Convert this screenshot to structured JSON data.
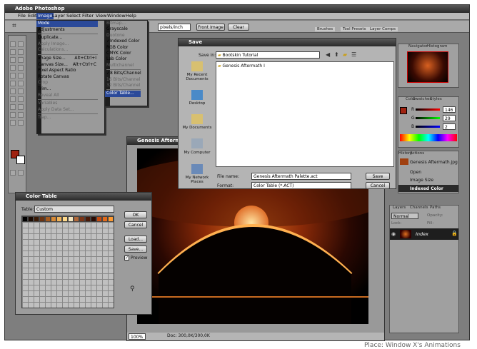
{
  "app": {
    "title": "Adobe Photoshop",
    "close_glyph": "✕",
    "accent": "#1a5fd6"
  },
  "menubar": [
    "File",
    "Edit",
    "Image",
    "Layer",
    "Select",
    "Filter",
    "View",
    "Window",
    "Help"
  ],
  "options": {
    "resolution_unit": "pixels/inch",
    "front_image": "Front Image",
    "clear": "Clear"
  },
  "top_tabs": [
    "Brushes",
    "Tool Presets",
    "Layer Comps"
  ],
  "image_menu": {
    "items": [
      {
        "label": "Mode",
        "hl": true
      },
      {
        "label": "Adjustments"
      },
      {
        "sep": true
      },
      {
        "label": "Duplicate..."
      },
      {
        "label": "Apply Image...",
        "dis": true
      },
      {
        "label": "Calculations...",
        "dis": true
      },
      {
        "sep": true
      },
      {
        "label": "Image Size...",
        "sc": "Alt+Ctrl+I"
      },
      {
        "label": "Canvas Size...",
        "sc": "Alt+Ctrl+C"
      },
      {
        "label": "Pixel Aspect Ratio"
      },
      {
        "label": "Rotate Canvas"
      },
      {
        "label": "Crop",
        "dis": true
      },
      {
        "label": "Trim..."
      },
      {
        "label": "Reveal All",
        "dis": true
      },
      {
        "sep": true
      },
      {
        "label": "Variables",
        "dis": true
      },
      {
        "label": "Apply Data Set...",
        "dis": true
      },
      {
        "sep": true
      },
      {
        "label": "Trap...",
        "dis": true
      }
    ]
  },
  "mode_menu": {
    "items": [
      {
        "label": "Bitmap...",
        "dis": true
      },
      {
        "label": "Grayscale"
      },
      {
        "label": "Duotone",
        "dis": true
      },
      {
        "label": "Indexed Color",
        "chk": true
      },
      {
        "label": "RGB Color"
      },
      {
        "label": "CMYK Color"
      },
      {
        "label": "Lab Color"
      },
      {
        "label": "Multichannel",
        "dis": true
      },
      {
        "sep": true
      },
      {
        "label": "8 Bits/Channel",
        "chk": true
      },
      {
        "label": "16 Bits/Channel",
        "dis": true
      },
      {
        "label": "32 Bits/Channel",
        "dis": true
      },
      {
        "sep": true
      },
      {
        "label": "Color Table...",
        "hl": true
      }
    ]
  },
  "save_dialog": {
    "title": "Save",
    "save_in_label": "Save in:",
    "save_in_value": "Bootskin Tutorial",
    "places": [
      "My Recent Documents",
      "Desktop",
      "My Documents",
      "My Computer",
      "My Network Places"
    ],
    "files": [
      "Genesis Aftermath I"
    ],
    "filename_label": "File name:",
    "filename_value": "Genesis Aftermath Palette.act",
    "format_label": "Format:",
    "format_value": "Color Table (*.ACT)",
    "save_btn": "Save",
    "cancel_btn": "Cancel"
  },
  "doc_window": {
    "title": "Genesis Aftermath",
    "zoom": "100%",
    "doc_info": "Doc: 300,0K/300,0K"
  },
  "color_table": {
    "title": "Color Table",
    "table_label": "Table:",
    "table_value": "Custom",
    "ok": "OK",
    "cancel": "Cancel",
    "load": "Load...",
    "save": "Save...",
    "preview": "Preview",
    "swatches": [
      "#000000",
      "#1a0a02",
      "#3a1a05",
      "#6b3210",
      "#a65a1e",
      "#d88a36",
      "#f0b45a",
      "#ffd98a",
      "#f5e6c0",
      "#b0683a",
      "#7a3416",
      "#4a1a08",
      "#2a0a02",
      "#c44a10",
      "#e26a1a",
      "#ff9a30",
      "#fff0d0",
      "#5a2a10",
      "#8a4a20",
      "#ffffff"
    ]
  },
  "navigator": {
    "tabs": [
      "Navigator",
      "Histogram"
    ]
  },
  "color_panel": {
    "tabs": [
      "Color",
      "Swatches",
      "Styles"
    ],
    "r_label": "R",
    "g_label": "G",
    "b_label": "B",
    "r": "146",
    "g": "29",
    "b": "2"
  },
  "history": {
    "tabs": [
      "History",
      "Actions"
    ],
    "snapshot": "Genesis Aftermath.jpg",
    "items": [
      "Open",
      "Image Size",
      "Indexed Color"
    ]
  },
  "layers": {
    "tabs": [
      "Layers",
      "Channels",
      "Paths"
    ],
    "blend": "Normal",
    "opacity_label": "Opacity:",
    "lock_label": "Lock:",
    "fill_label": "Fill:",
    "layer_name": "Index"
  },
  "bottom_caption": "Place: Window X's Animations"
}
